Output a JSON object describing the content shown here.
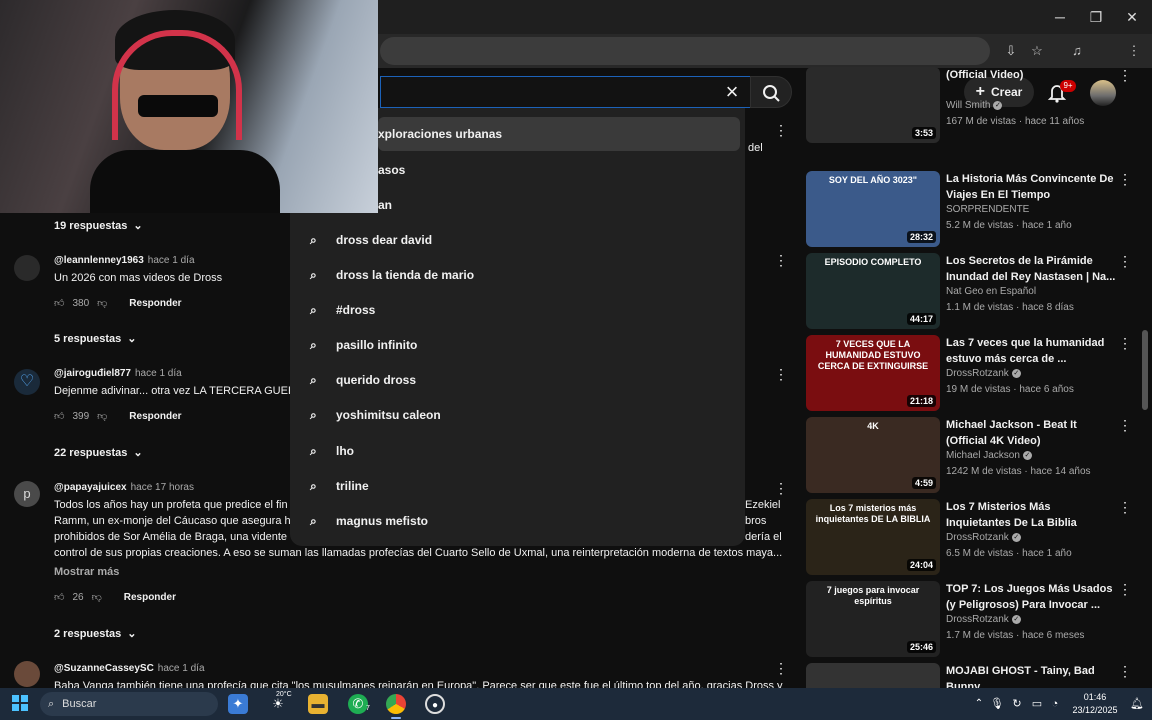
{
  "browser": {
    "window_controls": {
      "minimize": "─",
      "maximize": "❐",
      "close": "✕"
    }
  },
  "header": {
    "create_label": "Crear",
    "notifications_badge": "9+"
  },
  "search": {
    "suggestions": [
      "xploraciones urbanas",
      "asos",
      "an",
      "dross dear david",
      "dross la tienda de mario",
      "#dross",
      "pasillo infinito",
      "querido dross",
      "yoshimitsu caleon",
      "lho",
      "triline",
      "magnus mefisto"
    ],
    "hidden_right_text": "del"
  },
  "comments": {
    "c0": {
      "replies": "19 respuestas"
    },
    "c1": {
      "handle": "@leannlenney1963",
      "time": "hace 1 día",
      "text": "Un 2026 con mas videos de Dross",
      "likes": "380",
      "reply_label": "Responder",
      "replies": "5 respuestas"
    },
    "c2": {
      "handle": "@jairoguđiel877",
      "time": "hace 1 día",
      "text": "Dejenme adivinar... otra vez LA TERCERA GUERR",
      "likes": "399",
      "reply_label": "Responder",
      "replies": "22 respuestas"
    },
    "c3": {
      "handle": "@papayajuicex",
      "time": "hace 17 horas",
      "line1": "Todos los años hay un profeta que predice el fin",
      "line1_right": "Ezekiel",
      "line2": "Ramm, un ex-monje del Cáucaso que asegura h",
      "line2_right": "bros",
      "line3": "prohibidos de Sor Amélia de Braga, una vidente",
      "line3_right": "dería el",
      "line4": "control de sus propias creaciones. A eso se suman las llamadas profecías del Cuarto Sello de Uxmal, una reinterpretación moderna de textos maya...",
      "more": "Mostrar más",
      "likes": "26",
      "reply_label": "Responder",
      "replies": "2 respuestas"
    },
    "c4": {
      "handle": "@SuzanneCasseySC",
      "time": "hace 1 día",
      "text": "Baba Vanga también tiene una profecía que cita \"los musulmanes reinarán en Europa\". Parece ser que este fue el último top del año, gracias Dross y"
    }
  },
  "sidebar": {
    "videos": [
      {
        "title": "(Official Video)",
        "channel": "Will Smith",
        "verified": true,
        "views": "167 M de vistas",
        "age": "hace 11 años",
        "duration": "3:53",
        "thumb_color": "#2a2a2a"
      },
      {
        "title": "La Historia Más Convincente De Viajes En El Tiempo",
        "channel": "SORPRENDENTE",
        "verified": false,
        "views": "5.2 M de vistas",
        "age": "hace 1 año",
        "duration": "28:32",
        "thumb_text": "SOY DEL AÑO 3023\"",
        "thumb_color": "#3b5a8a"
      },
      {
        "title": "Los Secretos de la Pirámide Inundad del Rey Nastasen | Na...",
        "channel": "Nat Geo en Español",
        "verified": false,
        "views": "1.1 M de vistas",
        "age": "hace 8 días",
        "duration": "44:17",
        "thumb_text": "EPISODIO COMPLETO",
        "thumb_color": "#1d2b2b"
      },
      {
        "title": "Las 7 veces que la humanidad estuvo más cerca de ...",
        "channel": "DrossRotzank",
        "verified": true,
        "views": "19 M de vistas",
        "age": "hace 6 años",
        "duration": "21:18",
        "thumb_text": "7 VECES QUE LA HUMANIDAD ESTUVO CERCA DE EXTINGUIRSE",
        "thumb_color": "#7a0d10"
      },
      {
        "title": "Michael Jackson - Beat It (Official 4K Video)",
        "channel": "Michael Jackson",
        "verified": true,
        "views": "1242 M de vistas",
        "age": "hace 14 años",
        "duration": "4:59",
        "thumb_text": "4K",
        "thumb_color": "#3a2a22"
      },
      {
        "title": "Los 7 Misterios Más Inquietantes De La Biblia",
        "channel": "DrossRotzank",
        "verified": true,
        "views": "6.5 M de vistas",
        "age": "hace 1 año",
        "duration": "24:04",
        "thumb_text": "Los 7 misterios más inquietantes DE LA BIBLIA",
        "thumb_color": "#2b2418"
      },
      {
        "title": "TOP 7: Los Juegos Más Usados (y Peligrosos) Para Invocar ...",
        "channel": "DrossRotzank",
        "verified": true,
        "views": "1.7 M de vistas",
        "age": "hace 6 meses",
        "duration": "25:46",
        "thumb_text": "7 juegos para invocar espíritus",
        "thumb_color": "#222"
      },
      {
        "title": "MOJABI GHOST - Tainy, Bad Bunny",
        "channel": "",
        "verified": false,
        "views": "",
        "age": "",
        "duration": "",
        "thumb_color": "#333"
      }
    ]
  },
  "taskbar": {
    "search_placeholder": "Buscar",
    "weather": "20°C",
    "whatsapp_badge": "7",
    "time": "01:46",
    "date": "23/12/2025"
  }
}
